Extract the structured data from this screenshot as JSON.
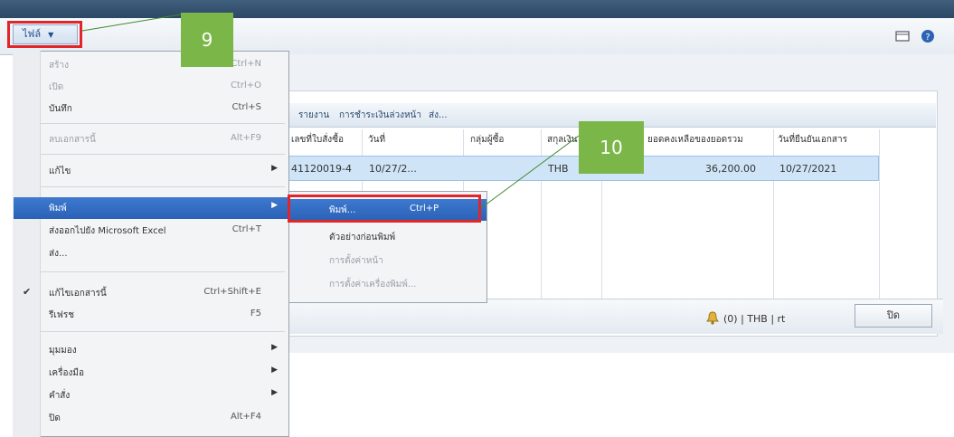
{
  "file_menu_button": {
    "label": "ไฟล์"
  },
  "callouts": {
    "step_9": "9",
    "step_10": "10"
  },
  "file_menu": {
    "items": [
      {
        "label": "สร้าง",
        "shortcut": "Ctrl+N"
      },
      {
        "label": "เปิด",
        "shortcut": "Ctrl+O"
      },
      {
        "label": "บันทึก",
        "shortcut": "Ctrl+S"
      },
      {
        "label": "ลบเอกสารนี้",
        "shortcut": "Alt+F9"
      },
      {
        "label": "แก้ไข"
      },
      {
        "label": "พิมพ์"
      },
      {
        "label": "ส่งออกไปยัง Microsoft Excel",
        "shortcut": "Ctrl+T"
      },
      {
        "label": "ส่ง..."
      },
      {
        "label": "แก้ไขเอกสารนี้",
        "shortcut": "Ctrl+Shift+E"
      },
      {
        "label": "รีเฟรช",
        "shortcut": "F5"
      },
      {
        "label": "มุมมอง"
      },
      {
        "label": "เครื่องมือ"
      },
      {
        "label": "คำสั่ง"
      },
      {
        "label": "ปิด",
        "shortcut": "Alt+F4"
      }
    ]
  },
  "print_submenu": {
    "items": [
      {
        "label": "พิมพ์...",
        "shortcut": "Ctrl+P"
      },
      {
        "label": "ตัวอย่างก่อนพิมพ์"
      },
      {
        "label": "การตั้งค่าหน้า"
      },
      {
        "label": "การตั้งค่าเครื่องพิมพ์..."
      }
    ]
  },
  "actions": {
    "a1": "รายงาน",
    "a2": "การชำระเงินล่วงหน้า",
    "a3": "ส่ง..."
  },
  "grid": {
    "headers": [
      "เลขที่ใบสั่งซื้อ",
      "วันที่",
      "กลุ่มผู้ซื้อ",
      "สกุลเงิน",
      "ยอดคงเหลือของยอดรวม",
      "วันที่ยืนยันเอกสาร"
    ],
    "row": {
      "doc_no": "41120019-4",
      "date": "10/27/2...",
      "currency": "THB",
      "amount": "36,200.00",
      "confirm_date": "10/27/2021"
    }
  },
  "status": {
    "text": "(0)  |  THB  |  rt",
    "close_label": "ปิด"
  }
}
